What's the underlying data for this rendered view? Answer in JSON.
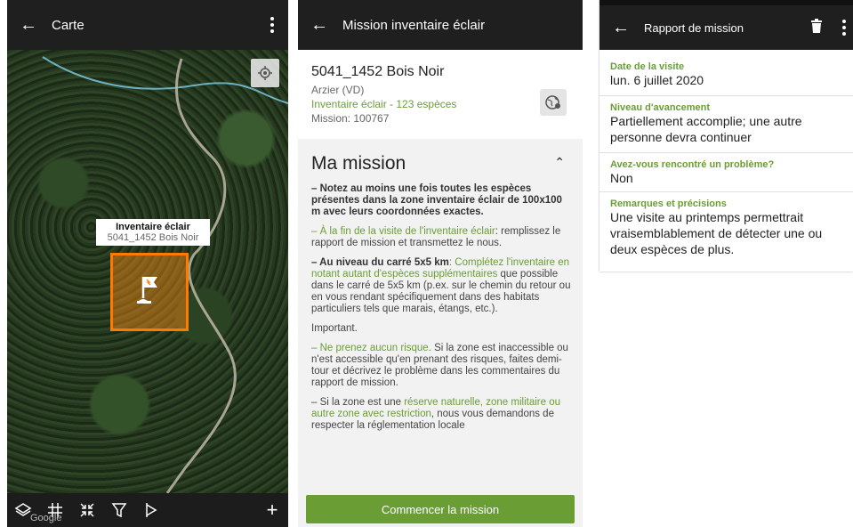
{
  "map_screen": {
    "title": "Carte",
    "callout_title": "Inventaire éclair",
    "callout_subtitle": "5041_1452 Bois Noir",
    "google_watermark": "Google",
    "add_label": "+",
    "toolbar_icons": [
      "layers-icon",
      "grid-icon",
      "collapse-icon",
      "filter-icon",
      "navigate-icon"
    ],
    "zone_color": "#ff7a00"
  },
  "mission_screen": {
    "title": "Mission inventaire éclair",
    "site_name": "5041_1452 Bois Noir",
    "location": "Arzier (VD)",
    "inventory": "Inventaire éclair  - 123 espèces",
    "mission_id": "Mission: 100767",
    "section_title": "Ma mission",
    "p1": "– Notez au moins une fois toutes les espèces présentes dans la zone inventaire éclair de 100x100 m avec leurs coordonnées exactes.",
    "p2_green": "– À la fin de la visite de l'inventaire éclair",
    "p2_rest": ": remplissez le rapport de mission et transmettez le nous.",
    "p3_bold": "– Au niveau du carré 5x5 km",
    "p3_green": ": Complétez l'inventaire en notant autant d'espèces supplémentaires",
    "p3_rest": " que possible dans le carré de 5x5 km (p.ex. sur le chemin du retour ou en vous rendant spécifiquement dans des habitats particuliers tels que marais, étangs, etc.).",
    "important": "Important.",
    "p4_green": "– Ne prenez aucun risque.",
    "p4_rest": " Si la zone est inaccessible ou n'est accessible qu'en prenant des risques, faites demi-tour et décrivez le problème dans les commentaires du rapport de mission.",
    "p5_start": "– Si la zone est une ",
    "p5_green": "réserve naturelle, zone militaire ou autre zone avec restriction",
    "p5_rest": ", nous vous demandons de respecter la réglementation locale",
    "start_button": "Commencer la mission",
    "accent": "#6a9e35"
  },
  "report_screen": {
    "title": "Rapport de mission",
    "fields": [
      {
        "label": "Date de la visite",
        "value": "lun. 6 juillet 2020"
      },
      {
        "label": "Niveau d'avancement",
        "value": "Partiellement accomplie; une autre personne devra continuer"
      },
      {
        "label": "Avez-vous rencontré un problème?",
        "value": "Non"
      },
      {
        "label": "Remarques et précisions",
        "value": "Une visite au printemps permettrait vraisemblablement de détecter une ou deux espèces de plus."
      }
    ]
  }
}
